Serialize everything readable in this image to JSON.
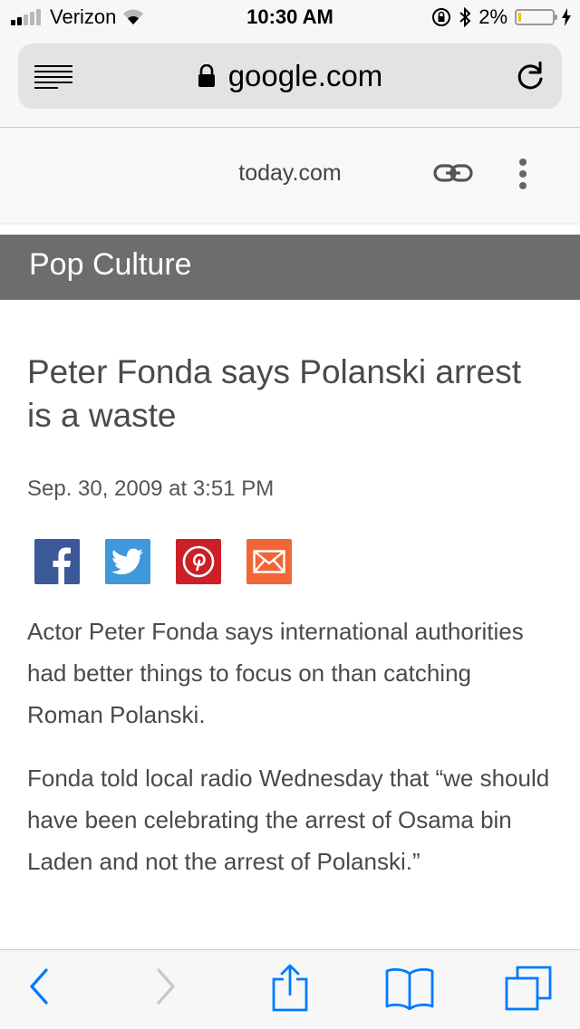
{
  "status_bar": {
    "carrier": "Verizon",
    "time": "10:30 AM",
    "battery_percent": "2%",
    "battery_level": 0.02,
    "signal_bars": 2
  },
  "browser": {
    "url": "google.com"
  },
  "amp_header": {
    "domain": "today.com"
  },
  "section": {
    "title": "Pop Culture"
  },
  "article": {
    "headline": "Peter Fonda says Polanski arrest is a waste",
    "date": "Sep. 30, 2009 at 3:51 PM",
    "paragraphs": [
      "Actor Peter Fonda says international authorities had better things to focus on than catching Roman Polanski.",
      "Fonda told local radio Wednesday that “we should have been celebrating the arrest of Osama bin Laden and not the arrest of Polanski.”"
    ]
  },
  "share_icons": [
    "facebook-icon",
    "twitter-icon",
    "pinterest-icon",
    "email-icon"
  ],
  "colors": {
    "accent": "#007aff",
    "section_bar": "#6d6d6d",
    "facebook": "#3b5998",
    "twitter": "#3e98da",
    "pinterest": "#cb2027",
    "email": "#f26536",
    "battery_low": "#f2c200"
  }
}
